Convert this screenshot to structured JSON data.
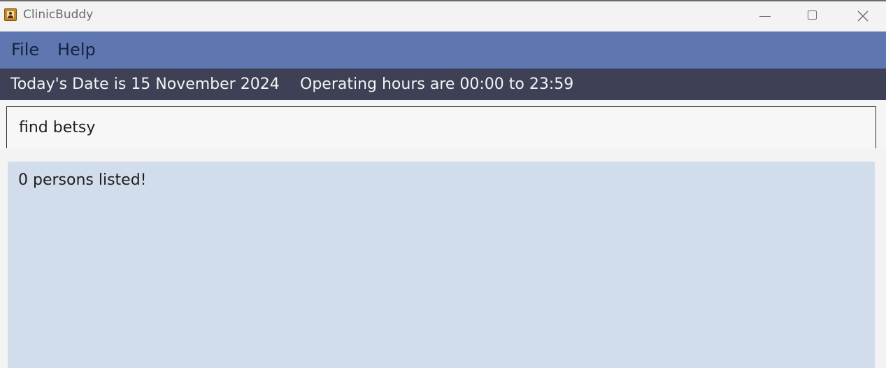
{
  "window": {
    "title": "ClinicBuddy",
    "icon": "app-icon"
  },
  "menu": {
    "items": [
      {
        "label": "File"
      },
      {
        "label": "Help"
      }
    ]
  },
  "status": {
    "date_text": "Today's Date is 15 November 2024",
    "hours_text": "Operating hours are 00:00 to 23:59"
  },
  "command": {
    "value": "find betsy"
  },
  "result": {
    "message": "0 persons listed!"
  },
  "colors": {
    "menubar": "#5e77b1",
    "infobar": "#3e4055",
    "result_panel": "#d2ddec"
  }
}
